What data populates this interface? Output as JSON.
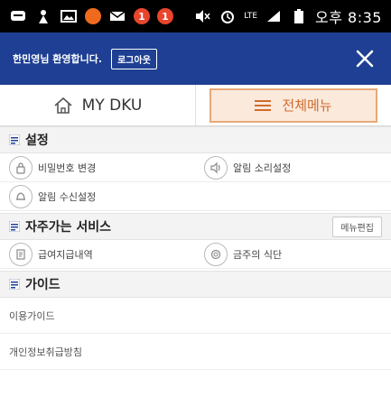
{
  "statusbar": {
    "badge_1": "1",
    "badge_2": "1",
    "network": "LTE",
    "time": "오후 8:35",
    "icons": [
      "chat-icon",
      "person-icon",
      "gallery-icon",
      "notification-dot-icon",
      "mail-icon",
      "mute-icon",
      "alarm-icon",
      "signal-icon",
      "battery-icon"
    ]
  },
  "header": {
    "welcome_text": "한민영님 환영합니다.",
    "logout_label": "로그아웃"
  },
  "tabs": [
    {
      "label": "MY DKU",
      "icon": "home-icon"
    },
    {
      "label": "전체메뉴",
      "icon": "menu-icon"
    }
  ],
  "sections": {
    "settings": {
      "title": "설정",
      "items": [
        {
          "label": "비밀번호 변경",
          "icon": "lock-icon"
        },
        {
          "label": "알림 소리설정",
          "icon": "sound-icon"
        },
        {
          "label": "알림 수신설정",
          "icon": "bell-icon"
        }
      ]
    },
    "services": {
      "title": "자주가는 서비스",
      "edit_label": "메뉴편집",
      "items": [
        {
          "label": "급여지급내역",
          "icon": "document-icon"
        },
        {
          "label": "금주의 식단",
          "icon": "meal-icon"
        }
      ]
    },
    "guide": {
      "title": "가이드",
      "items": [
        {
          "label": "이용가이드"
        },
        {
          "label": "개인정보취급방침"
        }
      ]
    }
  },
  "colors": {
    "header_bg": "#1e3f93",
    "active_tab_bg": "#fbe9dc",
    "active_tab_border": "#e7a978",
    "active_tab_text": "#d06b2c"
  }
}
